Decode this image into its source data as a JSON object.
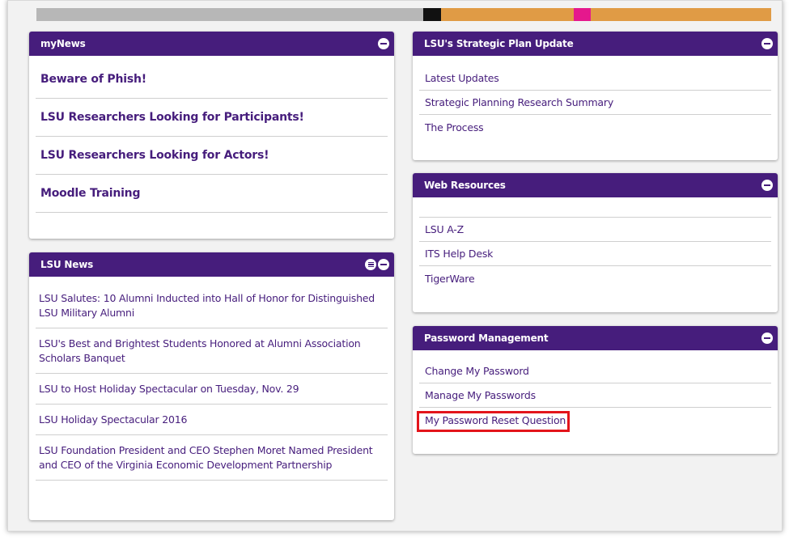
{
  "colors": {
    "header_purple": "#461d7c",
    "link_purple": "#461d7c",
    "highlight_red": "#e3141b",
    "strip": [
      "#b7b7b7",
      "#111111",
      "#e09b45",
      "#e5188d",
      "#e09b45"
    ]
  },
  "mynews": {
    "title": "myNews",
    "items": [
      "Beware of Phish!",
      "LSU Researchers Looking for Participants!",
      "LSU Researchers Looking for Actors!",
      "Moodle Training"
    ]
  },
  "lsunews": {
    "title": "LSU News",
    "items": [
      "LSU Salutes: 10 Alumni Inducted into Hall of Honor for Distinguished LSU Military Alumni",
      "LSU's Best and Brightest Students Honored at Alumni Association Scholars Banquet",
      "LSU to Host Holiday Spectacular on Tuesday, Nov. 29",
      "LSU Holiday Spectacular 2016",
      "LSU Foundation President and CEO Stephen Moret Named President and CEO of the Virginia Economic Development Partnership"
    ]
  },
  "strategic": {
    "title": "LSU's Strategic Plan Update",
    "items": [
      "Latest Updates",
      "Strategic Planning Research Summary",
      "The Process"
    ]
  },
  "web": {
    "title": "Web Resources",
    "items": [
      "LSU A-Z",
      "ITS Help Desk",
      "TigerWare"
    ]
  },
  "password": {
    "title": "Password Management",
    "items": [
      "Change My Password",
      "Manage My Passwords",
      "My Password Reset Question"
    ]
  }
}
